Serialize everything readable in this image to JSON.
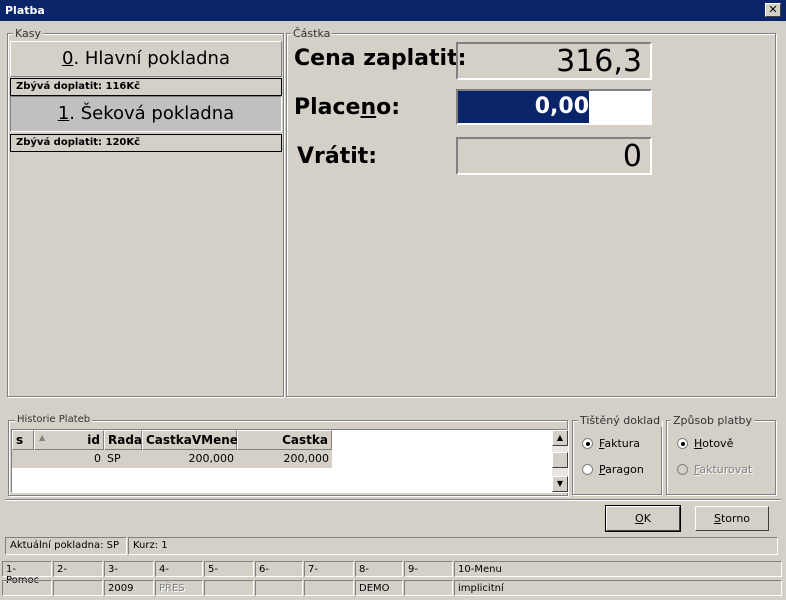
{
  "window": {
    "title": "Platba",
    "close_glyph": "✕"
  },
  "kasy": {
    "label": "Kasy",
    "items": [
      {
        "hotkey": "0",
        "name": ". Hlavní pokladna",
        "info": "Zbývá doplatit: 116Kč"
      },
      {
        "hotkey": "1",
        "name": ". Šeková pokladna",
        "info": "Zbývá doplatit: 120Kč"
      }
    ]
  },
  "castka": {
    "label": "Částka",
    "cena_label": "Cena zaplatit:",
    "cena_value": "316,3",
    "placeno_label_pre": "Place",
    "placeno_label_hot": "n",
    "placeno_label_post": "o:",
    "placeno_value": "0,00",
    "vratit_label": "Vrátit:",
    "vratit_value": "0"
  },
  "historie": {
    "label": "Historie Plateb",
    "columns": [
      "s",
      "id",
      "Rada",
      "CastkaVMene",
      "Castka"
    ],
    "rows": [
      {
        "s": "",
        "id": "0",
        "rada": "SP",
        "castka_v_mene": "200,000",
        "castka": "200,000"
      }
    ]
  },
  "doklad": {
    "label": "Tištěný doklad",
    "options": [
      {
        "hot": "F",
        "rest": "aktura",
        "selected": true
      },
      {
        "hot": "P",
        "rest": "aragon",
        "selected": false
      }
    ]
  },
  "zpusob": {
    "label": "Způsob platby",
    "options": [
      {
        "hot": "H",
        "rest": "otově",
        "selected": true,
        "disabled": false
      },
      {
        "hot": "F",
        "rest": "akturovat",
        "selected": false,
        "disabled": true
      }
    ]
  },
  "buttons": {
    "ok": {
      "hot": "O",
      "rest": "K"
    },
    "storno": {
      "hot": "S",
      "rest": "torno"
    }
  },
  "status": {
    "pokladna": "Aktuální pokladna: SP",
    "kurz": "Kurz: 1"
  },
  "fkeys": {
    "top": [
      "1-Pomoc",
      "2-",
      "3-",
      "4-",
      "5-",
      "6-",
      "7-",
      "8-",
      "9-",
      "10-Menu"
    ],
    "bottom": [
      "",
      "",
      "2009",
      "PŘES",
      "",
      "",
      "",
      "DEMO",
      "",
      "implicitní"
    ]
  }
}
